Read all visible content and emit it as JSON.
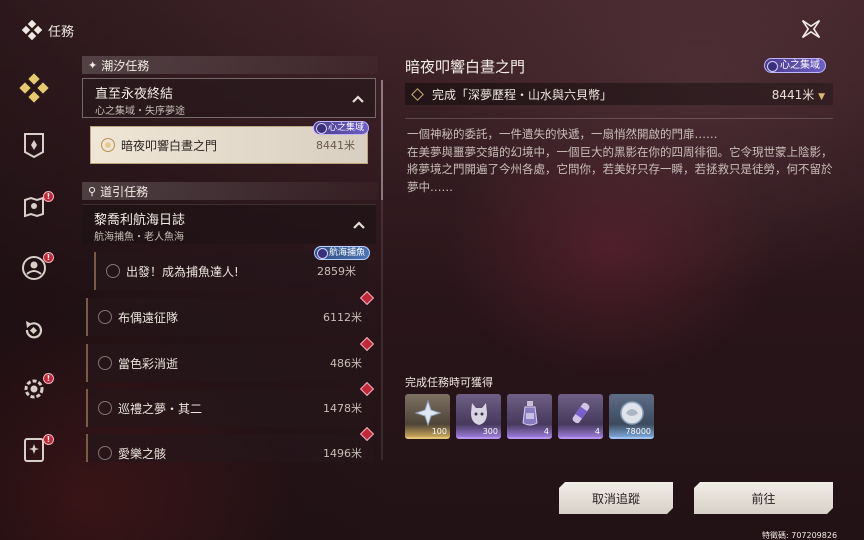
{
  "header": {
    "title": "任務"
  },
  "sidebar": {
    "items": [
      {
        "icon": "quest-diamond-icon",
        "alert": false,
        "active": true
      },
      {
        "icon": "banner-shield-icon",
        "alert": false
      },
      {
        "icon": "map-pin-icon",
        "alert": true
      },
      {
        "icon": "character-icon",
        "alert": true
      },
      {
        "icon": "return-arrow-icon",
        "alert": false
      },
      {
        "icon": "gear-icon",
        "alert": true
      },
      {
        "icon": "book-icon",
        "alert": true
      }
    ],
    "alert_mark": "!"
  },
  "list": {
    "section1": {
      "label": "潮汐任務"
    },
    "group1": {
      "title": "直至永夜終結",
      "subtitle": "心之集域・失序夢途"
    },
    "selected_quest": {
      "name": "暗夜叩響白晝之門",
      "distance": "8441米",
      "tag": "心之集域"
    },
    "section2": {
      "label": "道引任務"
    },
    "group2": {
      "title": "黎喬利航海日誌",
      "subtitle": "航海捕魚・老人魚海"
    },
    "quests": [
      {
        "name": "出發！成為捕魚達人!",
        "distance": "2859米",
        "tag": "航海捕魚"
      },
      {
        "name": "布偶遠征隊",
        "distance": "6112米"
      },
      {
        "name": "當色彩消逝",
        "distance": "486米"
      },
      {
        "name": "巡禮之夢・其二",
        "distance": "1478米"
      },
      {
        "name": "愛樂之骸",
        "distance": "1496米"
      }
    ]
  },
  "detail": {
    "title": "暗夜叩響白晝之門",
    "tag": "心之集域",
    "objective": "完成「深夢歷程・山水與六貝幣」",
    "objective_distance": "8441米",
    "description": "一個神秘的委託，一件遺失的快遞，一扇悄然開啟的門扉……\n在美夢與噩夢交錯的幻境中，一個巨大的黑影在你的四周徘徊。它令現世蒙上陰影，將夢境之門開遍了今州各處，它問你，若美好只存一瞬，若拯救只是徒勞，何不留於夢中……",
    "rewards_label": "完成任務時可獲得",
    "rewards": [
      {
        "qty": "100",
        "rarity": "gold",
        "icon": "crystal-icon"
      },
      {
        "qty": "300",
        "rarity": "purple",
        "icon": "beast-icon"
      },
      {
        "qty": "4",
        "rarity": "purple",
        "icon": "potion-icon"
      },
      {
        "qty": "4",
        "rarity": "purple",
        "icon": "capsule-icon"
      },
      {
        "qty": "78000",
        "rarity": "blue",
        "icon": "shell-coin-icon"
      }
    ]
  },
  "buttons": {
    "cancel": "取消追蹤",
    "go": "前往"
  },
  "uid": "特徵碼: 707209826",
  "colors": {
    "accent_gold": "#d7b774",
    "alert_red": "#c0283a",
    "tag_purple": "#6d5fc4"
  }
}
